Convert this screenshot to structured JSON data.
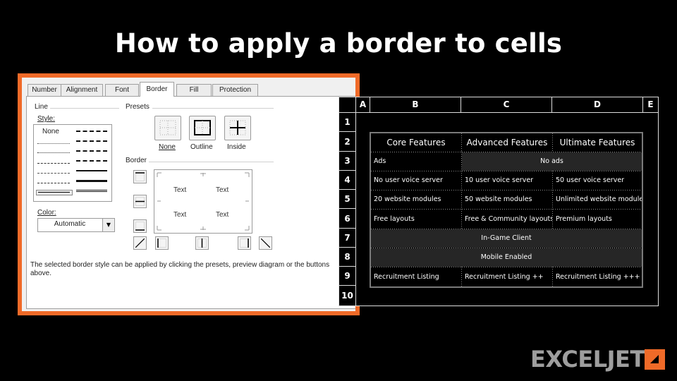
{
  "title": "How to apply a border to cells",
  "dialog": {
    "tabs": [
      "Number",
      "Alignment",
      "Font",
      "Border",
      "Fill",
      "Protection"
    ],
    "active_tab": "Border",
    "line_group": "Line",
    "style_label": "Style:",
    "style_none": "None",
    "color_label": "Color:",
    "color_value": "Automatic",
    "presets_label": "Presets",
    "preset_none": "None",
    "preset_outline": "Outline",
    "preset_inside": "Inside",
    "border_label": "Border",
    "preview_text": [
      "Text",
      "Text",
      "Text",
      "Text"
    ],
    "help_text": "The selected border style can be applied by clicking the presets, preview diagram or the buttons above."
  },
  "sheet": {
    "columns": [
      "A",
      "B",
      "C",
      "D",
      "E"
    ],
    "rows": [
      "1",
      "2",
      "3",
      "4",
      "5",
      "6",
      "7",
      "8",
      "9",
      "10"
    ],
    "table": {
      "headers": [
        "Core Features",
        "Advanced Features",
        "Ultimate Features"
      ],
      "r3": {
        "b": "Ads",
        "cd": "No ads"
      },
      "r4": [
        "No user voice server",
        "10 user voice server",
        "50 user voice server"
      ],
      "r5": [
        "20 website modules",
        "50 website modules",
        "Unlimited website modules"
      ],
      "r6": [
        "Free layouts",
        "Free & Community layouts",
        "Premium layouts"
      ],
      "r7": "In-Game Client",
      "r8": "Mobile Enabled",
      "r9": [
        "Recruitment Listing",
        "Recruitment Listing ++",
        "Recruitment Listing +++"
      ]
    }
  },
  "logo": {
    "text": "EXCELJET",
    "accent": "#f06a28"
  }
}
